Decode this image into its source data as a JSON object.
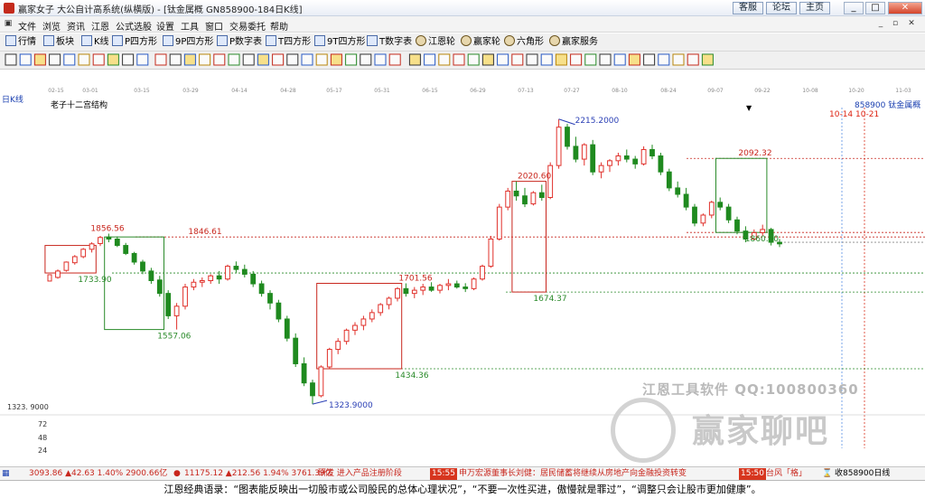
{
  "window": {
    "title": "赢家女子 大公自计高系统(纵横版) - [钛金属概 GN858900-184日K线]",
    "top_links": [
      "客服",
      "论坛",
      "主页"
    ]
  },
  "menu": [
    "文件",
    "浏览",
    "资讯",
    "江恩",
    "公式选股",
    "设置",
    "工具",
    "窗口",
    "交易委托",
    "帮助"
  ],
  "toolbar": [
    "行情",
    "板块",
    "K线",
    "P四方形",
    "9P四方形",
    "P数字表",
    "T四方形",
    "9T四方形",
    "T数字表",
    "江恩轮",
    "赢家轮",
    "六角形",
    "赢家服务"
  ],
  "chart_header": {
    "period": "日K线",
    "indicator": "老子十二宫结构",
    "code_name": "858900  钛金属概",
    "marker_dates": "10-14 10-21"
  },
  "axis": {
    "x_ticks": [
      "02-15",
      "03-01",
      "03-15",
      "03-29",
      "04-14",
      "04-28",
      "05-17",
      "05-31",
      "06-15",
      "06-29",
      "07-13",
      "07-27",
      "08-10",
      "08-24",
      "09-07",
      "09-22",
      "10-08",
      "10-20",
      "11-03"
    ],
    "y_labels": [
      "1323. 9000",
      "72",
      "48",
      "24"
    ]
  },
  "colors": {
    "up": "#e0302a",
    "down": "#1f8a1f",
    "price_label_up": "#c8261d",
    "price_label_down": "#2a8a2a",
    "low_high": "#2a3fb5"
  },
  "chart_data": {
    "type": "candlestick",
    "title": "老子十二宫结构",
    "ohlc": [
      [
        1720,
        1745,
        1716,
        1740
      ],
      [
        1742,
        1770,
        1738,
        1768
      ],
      [
        1766,
        1790,
        1760,
        1785
      ],
      [
        1785,
        1812,
        1780,
        1808
      ],
      [
        1808,
        1830,
        1798,
        1825
      ],
      [
        1826,
        1850,
        1818,
        1845
      ],
      [
        1846,
        1857,
        1830,
        1840
      ],
      [
        1840,
        1848,
        1815,
        1820
      ],
      [
        1820,
        1828,
        1790,
        1795
      ],
      [
        1795,
        1800,
        1760,
        1768
      ],
      [
        1768,
        1775,
        1730,
        1740
      ],
      [
        1740,
        1750,
        1700,
        1710
      ],
      [
        1712,
        1725,
        1660,
        1670
      ],
      [
        1670,
        1680,
        1590,
        1600
      ],
      [
        1600,
        1640,
        1557,
        1630
      ],
      [
        1630,
        1700,
        1620,
        1690
      ],
      [
        1690,
        1715,
        1680,
        1705
      ],
      [
        1705,
        1720,
        1690,
        1710
      ],
      [
        1710,
        1730,
        1700,
        1725
      ],
      [
        1725,
        1740,
        1700,
        1715
      ],
      [
        1715,
        1760,
        1710,
        1755
      ],
      [
        1755,
        1770,
        1735,
        1745
      ],
      [
        1745,
        1760,
        1720,
        1730
      ],
      [
        1730,
        1740,
        1690,
        1700
      ],
      [
        1700,
        1710,
        1660,
        1670
      ],
      [
        1670,
        1680,
        1620,
        1640
      ],
      [
        1640,
        1650,
        1580,
        1590
      ],
      [
        1590,
        1600,
        1520,
        1530
      ],
      [
        1530,
        1545,
        1440,
        1450
      ],
      [
        1450,
        1470,
        1380,
        1390
      ],
      [
        1390,
        1400,
        1323.9,
        1350
      ],
      [
        1350,
        1445,
        1345,
        1440
      ],
      [
        1440,
        1500,
        1435,
        1495
      ],
      [
        1495,
        1530,
        1480,
        1520
      ],
      [
        1520,
        1560,
        1510,
        1555
      ],
      [
        1555,
        1580,
        1540,
        1570
      ],
      [
        1570,
        1600,
        1555,
        1590
      ],
      [
        1590,
        1620,
        1580,
        1610
      ],
      [
        1610,
        1640,
        1600,
        1635
      ],
      [
        1635,
        1660,
        1620,
        1655
      ],
      [
        1655,
        1690,
        1645,
        1685
      ],
      [
        1685,
        1701.56,
        1660,
        1670
      ],
      [
        1670,
        1690,
        1655,
        1680
      ],
      [
        1680,
        1700,
        1665,
        1690
      ],
      [
        1690,
        1705,
        1675,
        1680
      ],
      [
        1680,
        1700,
        1670,
        1695
      ],
      [
        1695,
        1715,
        1680,
        1700
      ],
      [
        1700,
        1710,
        1685,
        1690
      ],
      [
        1690,
        1702,
        1674.37,
        1685
      ],
      [
        1685,
        1720,
        1680,
        1715
      ],
      [
        1715,
        1760,
        1710,
        1755
      ],
      [
        1755,
        1850,
        1750,
        1840
      ],
      [
        1840,
        1950,
        1835,
        1940
      ],
      [
        1940,
        2000,
        1930,
        1990
      ],
      [
        1990,
        2020.6,
        1960,
        1975
      ],
      [
        1975,
        2000,
        1940,
        1950
      ],
      [
        1950,
        1990,
        1945,
        1985
      ],
      [
        1985,
        2010,
        1960,
        1970
      ],
      [
        1970,
        2080,
        1965,
        2070
      ],
      [
        2070,
        2215,
        2060,
        2190
      ],
      [
        2190,
        2200,
        2120,
        2130
      ],
      [
        2130,
        2160,
        2080,
        2090
      ],
      [
        2090,
        2140,
        2070,
        2135
      ],
      [
        2135,
        2150,
        2040,
        2050
      ],
      [
        2050,
        2080,
        2030,
        2070
      ],
      [
        2070,
        2090,
        2050,
        2085
      ],
      [
        2085,
        2110,
        2070,
        2100
      ],
      [
        2100,
        2120,
        2080,
        2090
      ],
      [
        2090,
        2100,
        2060,
        2075
      ],
      [
        2075,
        2130,
        2070,
        2120
      ],
      [
        2120,
        2135,
        2090,
        2100
      ],
      [
        2100,
        2110,
        2040,
        2050
      ],
      [
        2050,
        2060,
        1990,
        2000
      ],
      [
        2000,
        2020,
        1970,
        1980
      ],
      [
        1980,
        2000,
        1930,
        1940
      ],
      [
        1940,
        1950,
        1880,
        1890
      ],
      [
        1890,
        1920,
        1880,
        1915
      ],
      [
        1915,
        1960,
        1905,
        1955
      ],
      [
        1955,
        1970,
        1930,
        1940
      ],
      [
        1940,
        1950,
        1890,
        1900
      ],
      [
        1900,
        1910,
        1855,
        1865
      ],
      [
        1865,
        1880,
        1830,
        1840
      ],
      [
        1840,
        1870,
        1835,
        1860
      ],
      [
        1860,
        1885,
        1850,
        1870
      ],
      [
        1870,
        1875,
        1820,
        1830
      ],
      [
        1830,
        1840,
        1815,
        1825
      ]
    ],
    "annotations": [
      {
        "text": "1856.56",
        "value": 1856.56
      },
      {
        "text": "1846.61",
        "value": 1846.61
      },
      {
        "text": "1733.90",
        "value": 1733.9
      },
      {
        "text": "1557.06",
        "value": 1557.06
      },
      {
        "text": "1701.56",
        "value": 1701.56
      },
      {
        "text": "1434.36",
        "value": 1434.36
      },
      {
        "text": "1323.9000",
        "value": 1323.9
      },
      {
        "text": "2020.60",
        "value": 2020.6
      },
      {
        "text": "1674.37",
        "value": 1674.37
      },
      {
        "text": "2215.2000",
        "value": 2215.2
      },
      {
        "text": "2092.32",
        "value": 2092.32
      },
      {
        "text": "1860.70",
        "value": 1860.7
      }
    ],
    "ylim": [
      1310,
      2240
    ]
  },
  "watermark": {
    "line1": "江恩工具软件  QQ:100800360",
    "line2": "赢家聊吧"
  },
  "ticker": {
    "sh_index": "3093.86 ▲42.63 1.40% 2900.66亿",
    "sz_index": "11175.12 ▲212.56 1.94% 3761.39亿",
    "notice": "研发 进入产品注册阶段",
    "news_time": "15:55",
    "news": "申万宏源董事长刘健：居民储蓄将继续从房地产向金融投资转变",
    "time2": "15:50",
    "news2": "台风「格」",
    "status": "收858900日线"
  },
  "caption": "江恩经典语录：“图表能反映出一切股市或公司股民的总体心理状况”，“不要一次性买进，傲慢就是罪过”，“调整只会让股市更加健康”。"
}
